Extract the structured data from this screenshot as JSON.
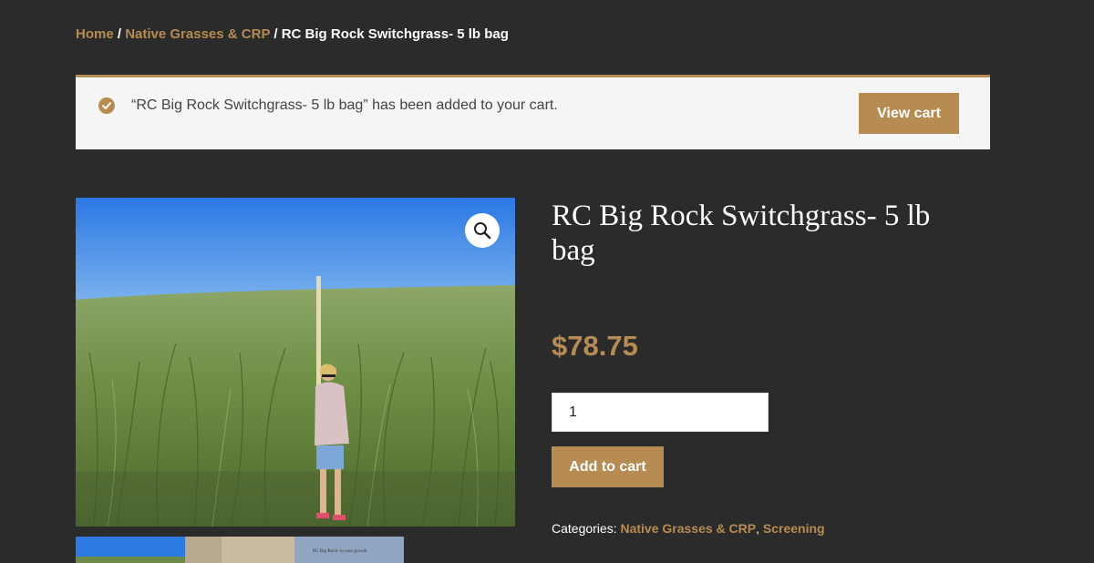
{
  "breadcrumb": {
    "home": "Home",
    "category": "Native Grasses & CRP",
    "current": "RC Big Rock Switchgrass- 5 lb bag",
    "separator": "/"
  },
  "notice": {
    "message": "“RC Big Rock Switchgrass- 5 lb bag” has been added to your cart.",
    "button_label": "View cart"
  },
  "product": {
    "title": "RC Big Rock Switchgrass- 5 lb bag",
    "price": "$78.75",
    "quantity": "1",
    "add_to_cart_label": "Add to cart",
    "categories_label": "Categories:",
    "categories": [
      "Native Grasses & CRP",
      "Screening"
    ]
  },
  "gallery": {
    "zoom_icon": "magnifier-icon",
    "thumbnail_caption": "RC Big Rock- in your growth"
  },
  "colors": {
    "background": "#2b2b2b",
    "accent": "#b68c52",
    "notice_bg": "#f5f5f5"
  }
}
